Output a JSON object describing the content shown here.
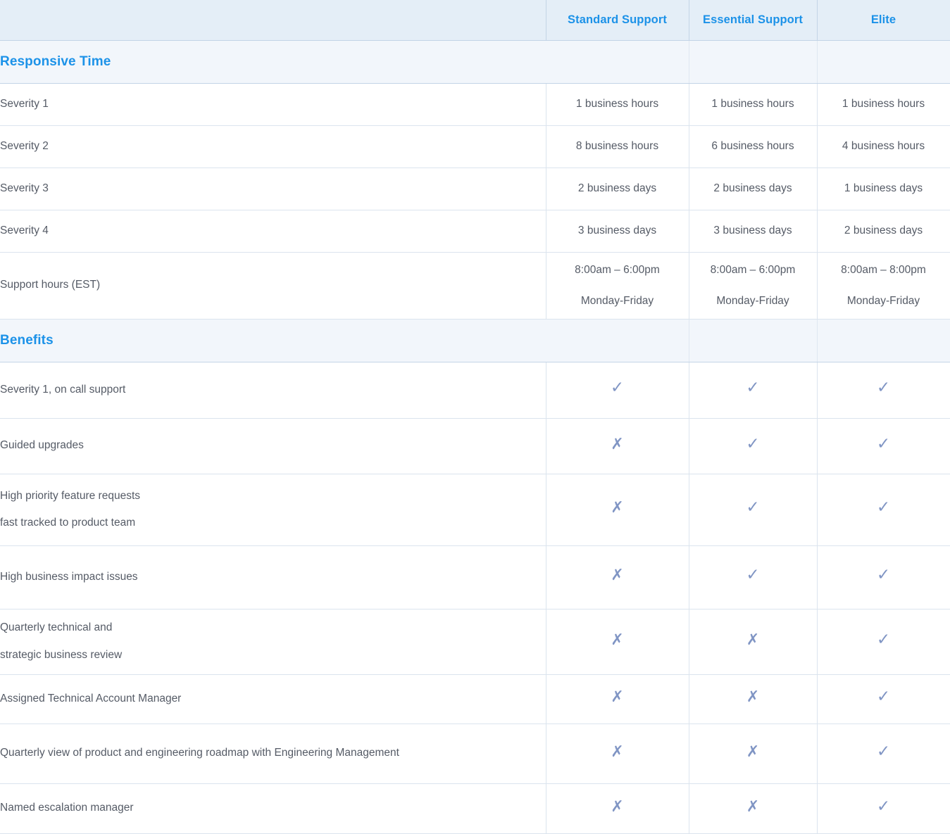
{
  "header": {
    "blank_label": "",
    "plans": [
      "Standard Support",
      "Essential Support",
      "Elite"
    ]
  },
  "sections": [
    {
      "title": "Responsive Time",
      "rows": [
        {
          "label": "Severity 1",
          "values": [
            "1 business hours",
            "1 business hours",
            "1 business hours"
          ]
        },
        {
          "label": "Severity 2",
          "values": [
            "8 business hours",
            "6 business hours",
            "4 business hours"
          ]
        },
        {
          "label": "Severity 3",
          "values": [
            "2 business days",
            "2 business days",
            "1 business days"
          ]
        },
        {
          "label": "Severity 4",
          "values": [
            "3 business days",
            "3 business days",
            "2 business days"
          ]
        },
        {
          "label": "Support hours (EST)",
          "values_line1": [
            "8:00am – 6:00pm",
            "8:00am – 6:00pm",
            "8:00am – 8:00pm"
          ],
          "values_line2": [
            "Monday-Friday",
            "Monday-Friday",
            "Monday-Friday"
          ]
        }
      ]
    },
    {
      "title": "Benefits",
      "rows": [
        {
          "label": "Severity 1, on call support",
          "marks": [
            "check",
            "check",
            "check"
          ]
        },
        {
          "label": "Guided upgrades",
          "marks": [
            "cross",
            "check",
            "check"
          ]
        },
        {
          "label_line1": "High priority feature requests",
          "label_line2": "fast tracked to product team",
          "marks": [
            "cross",
            "check",
            "check"
          ]
        },
        {
          "label": "High business impact issues",
          "marks": [
            "cross",
            "check",
            "check"
          ]
        },
        {
          "label_line1": "Quarterly technical and",
          "label_line2": "strategic business review",
          "marks": [
            "cross",
            "cross",
            "check"
          ]
        },
        {
          "label": "Assigned Technical Account Manager",
          "marks": [
            "cross",
            "cross",
            "check"
          ]
        },
        {
          "label": "Quarterly view of product and engineering roadmap with Engineering Management",
          "marks": [
            "cross",
            "cross",
            "check"
          ]
        },
        {
          "label": "Named escalation manager",
          "marks": [
            "cross",
            "cross",
            "check"
          ]
        }
      ]
    }
  ],
  "glyphs": {
    "check": "✓",
    "cross": "✗"
  },
  "colors": {
    "accent": "#1c92e8",
    "header_bg": "#e4eef7",
    "section_bg": "#f2f6fb",
    "mark": "#8095c4",
    "text": "#555b66",
    "border": "#dbe4ee"
  }
}
